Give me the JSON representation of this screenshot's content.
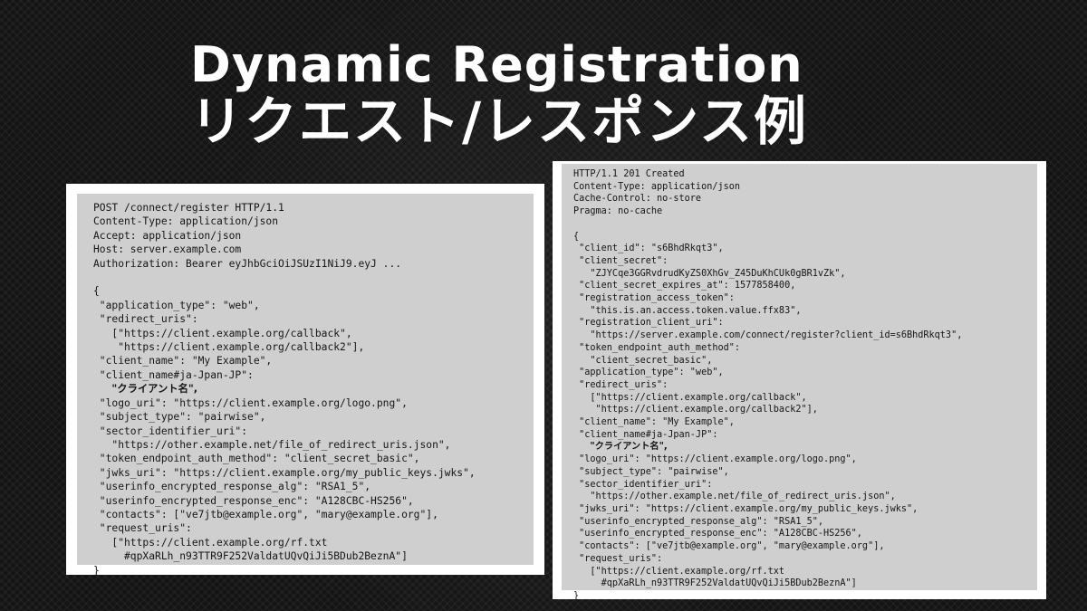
{
  "slide": {
    "title_line1": "Dynamic Registration",
    "title_line2": "リクエスト/レスポンス例"
  },
  "request": {
    "before": "POST /connect/register HTTP/1.1\nContent-Type: application/json\nAccept: application/json\nHost: server.example.com\nAuthorization: Bearer eyJhbGciOiJSUzI1NiJ9.eyJ ...\n\n{\n \"application_type\": \"web\",\n \"redirect_uris\":\n   [\"https://client.example.org/callback\",\n    \"https://client.example.org/callback2\"],\n \"client_name\": \"My Example\",\n \"client_name#ja-Jpan-JP\":\n   ",
    "client_name_ja": "\"クライアント名\",",
    "after": "\n \"logo_uri\": \"https://client.example.org/logo.png\",\n \"subject_type\": \"pairwise\",\n \"sector_identifier_uri\":\n   \"https://other.example.net/file_of_redirect_uris.json\",\n \"token_endpoint_auth_method\": \"client_secret_basic\",\n \"jwks_uri\": \"https://client.example.org/my_public_keys.jwks\",\n \"userinfo_encrypted_response_alg\": \"RSA1_5\",\n \"userinfo_encrypted_response_enc\": \"A128CBC-HS256\",\n \"contacts\": [\"ve7jtb@example.org\", \"mary@example.org\"],\n \"request_uris\":\n   [\"https://client.example.org/rf.txt\n     #qpXaRLh_n93TTR9F252ValdatUQvQiJi5BDub2BeznA\"]\n}"
  },
  "response": {
    "before": "HTTP/1.1 201 Created\nContent-Type: application/json\nCache-Control: no-store\nPragma: no-cache\n\n{\n \"client_id\": \"s6BhdRkqt3\",\n \"client_secret\":\n   \"ZJYCqe3GGRvdrudKyZS0XhGv_Z45DuKhCUk0gBR1vZk\",\n \"client_secret_expires_at\": 1577858400,\n \"registration_access_token\":\n   \"this.is.an.access.token.value.ffx83\",\n \"registration_client_uri\":\n   \"https://server.example.com/connect/register?client_id=s6BhdRkqt3\",\n \"token_endpoint_auth_method\":\n   \"client_secret_basic\",\n \"application_type\": \"web\",\n \"redirect_uris\":\n   [\"https://client.example.org/callback\",\n    \"https://client.example.org/callback2\"],\n \"client_name\": \"My Example\",\n \"client_name#ja-Jpan-JP\":\n   ",
    "client_name_ja": "\"クライアント名\",",
    "after": "\n \"logo_uri\": \"https://client.example.org/logo.png\",\n \"subject_type\": \"pairwise\",\n \"sector_identifier_uri\":\n   \"https://other.example.net/file_of_redirect_uris.json\",\n \"jwks_uri\": \"https://client.example.org/my_public_keys.jwks\",\n \"userinfo_encrypted_response_alg\": \"RSA1_5\",\n \"userinfo_encrypted_response_enc\": \"A128CBC-HS256\",\n \"contacts\": [\"ve7jtb@example.org\", \"mary@example.org\"],\n \"request_uris\":\n   [\"https://client.example.org/rf.txt\n     #qpXaRLh_n93TTR9F252ValdatUQvQiJi5BDub2BeznA\"]\n}"
  }
}
